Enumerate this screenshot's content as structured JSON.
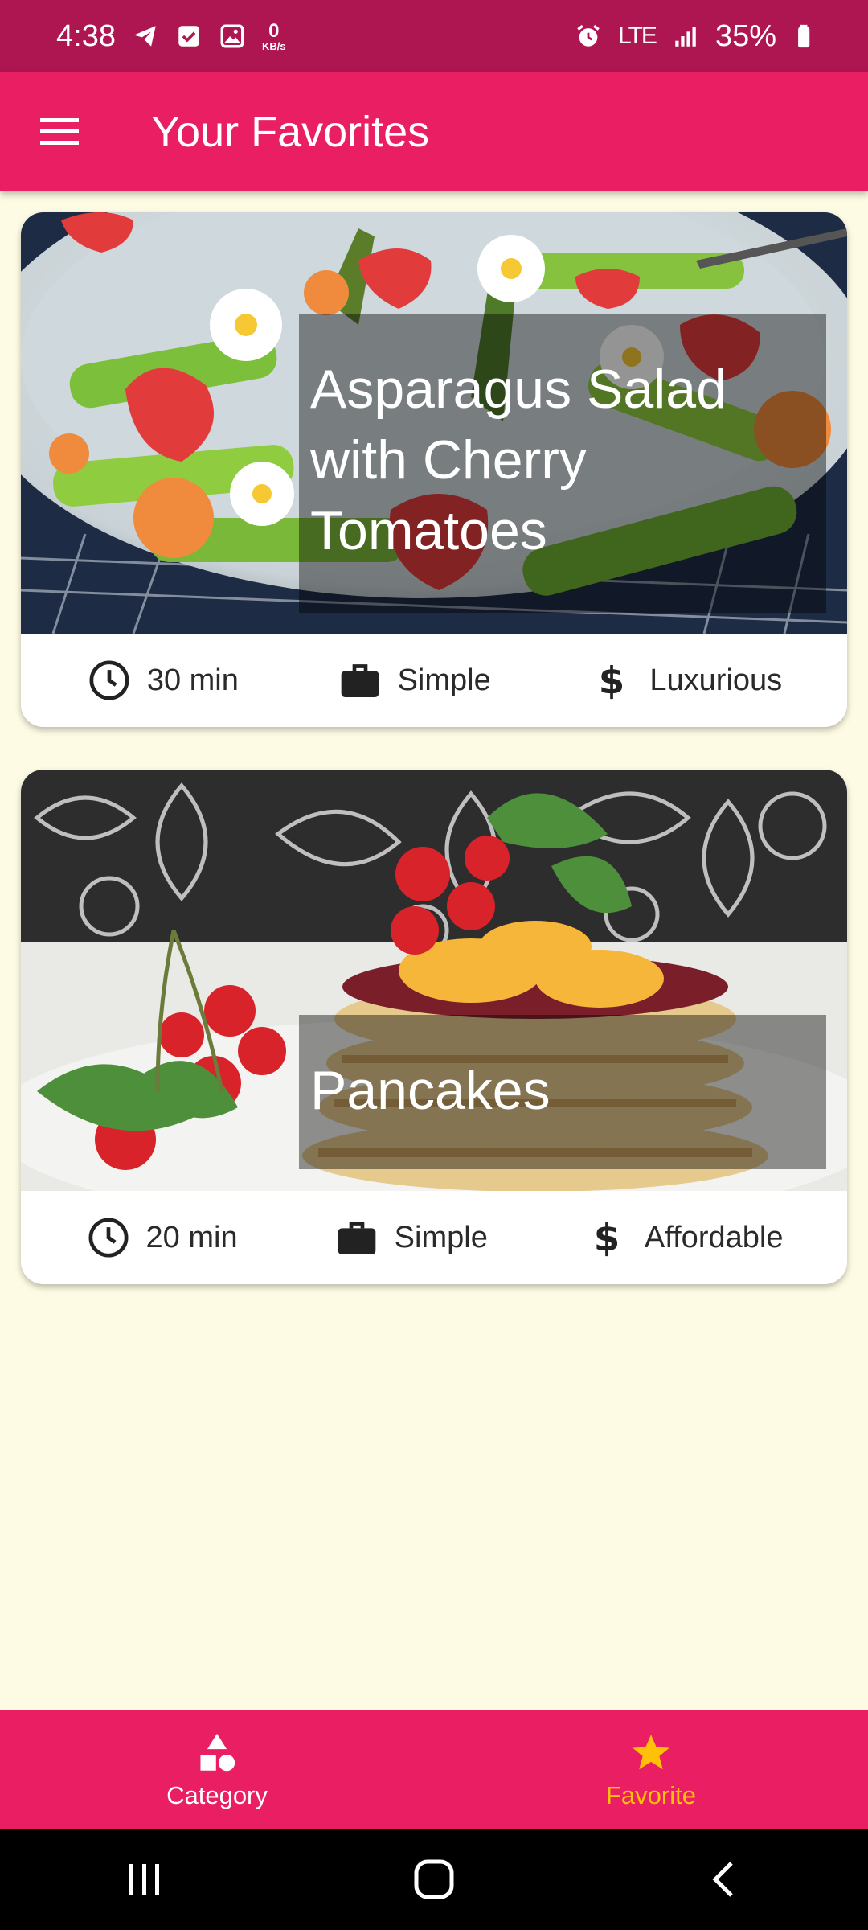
{
  "status_bar": {
    "time": "4:38",
    "net_speed_value": "0",
    "net_speed_unit": "KB/s",
    "network": "LTE",
    "battery": "35%",
    "icons": [
      "telegram-icon",
      "checkbox-icon",
      "gallery-icon",
      "alarm-icon",
      "signal-icon",
      "battery-icon"
    ]
  },
  "app_bar": {
    "title": "Your Favorites",
    "menu_icon": "menu-icon"
  },
  "meals": [
    {
      "title": "Asparagus Salad with Cherry Tomatoes",
      "duration": "30 min",
      "complexity": "Simple",
      "affordability": "Luxurious"
    },
    {
      "title": "Pancakes",
      "duration": "20 min",
      "complexity": "Simple",
      "affordability": "Affordable"
    }
  ],
  "bottom_nav": {
    "items": [
      {
        "label": "Category",
        "icon": "category-icon",
        "active": false
      },
      {
        "label": "Favorite",
        "icon": "star-icon",
        "active": true
      }
    ]
  },
  "colors": {
    "status_bar": "#ad1650",
    "primary": "#e91e63",
    "accent": "#ffc107",
    "background": "#fdfbe3"
  }
}
